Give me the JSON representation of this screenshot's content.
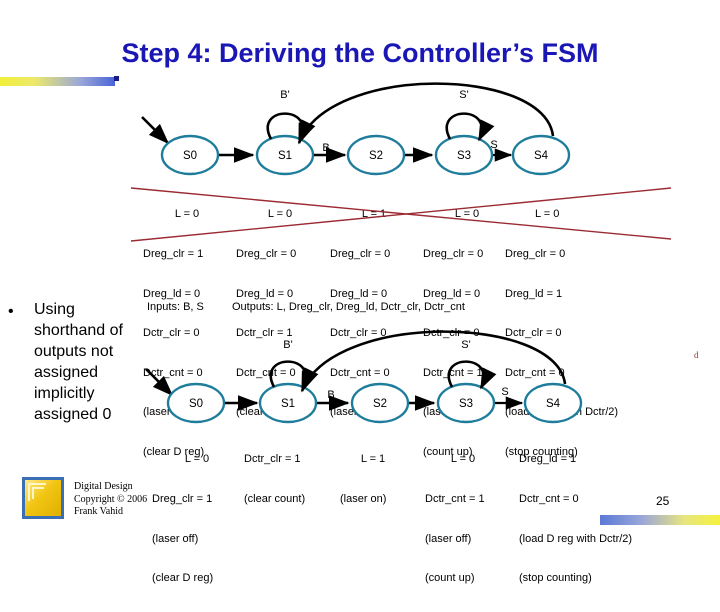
{
  "slide": {
    "title": "Step 4: Deriving the Controller’s FSM",
    "page_number": "25",
    "stray_mark": "d",
    "accent_color_start": "#f2ef3a",
    "accent_color_end": "#4a63d8",
    "title_color": "#1a17b5",
    "state_circle_color": "#1f7d9c",
    "strikeout_color": "#9c2a33"
  },
  "bullet": {
    "marker": "•",
    "text": "Using shorthand of outputs not assigned implicitly assigned 0"
  },
  "io_line": {
    "inputs": "Inputs: B, S",
    "outputs": "Outputs: L, Dreg_clr, Dreg_ld, Dctr_clr, Dctr_cnt"
  },
  "fsm_full": {
    "states": [
      "S0",
      "S1",
      "S2",
      "S3",
      "S4"
    ],
    "self_loop_labels": [
      {
        "state": "S1",
        "label": "B'"
      },
      {
        "state": "S3",
        "label": "S'"
      }
    ],
    "transition_labels": [
      {
        "from": "S1",
        "to": "S2",
        "label": "B"
      },
      {
        "from": "S3",
        "to": "S4",
        "label": "S"
      }
    ],
    "back_arc": {
      "from": "S4",
      "to": "S1",
      "label": ""
    },
    "outputs": [
      {
        "state": "S0",
        "header": "L = 0",
        "lines": [
          "Dreg_clr = 1",
          "Dreg_ld = 0",
          "Dctr_clr = 0",
          "Dctr_cnt = 0",
          "(laser off)",
          "(clear D reg)"
        ]
      },
      {
        "state": "S1",
        "header": "L = 0",
        "lines": [
          "Dreg_clr = 0",
          "Dreg_ld = 0",
          "Dctr_clr = 1",
          "Dctr_cnt = 0",
          "(clear count)"
        ]
      },
      {
        "state": "S2",
        "header": "L = 1",
        "lines": [
          "Dreg_clr = 0",
          "Dreg_ld = 0",
          "Dctr_clr = 0",
          "Dctr_cnt = 0",
          "(laser on)"
        ]
      },
      {
        "state": "S3",
        "header": "L = 0",
        "lines": [
          "Dreg_clr = 0",
          "Dreg_ld = 0",
          "Dctr_clr = 0",
          "Dctr_cnt = 1",
          "(laser off)",
          "(count up)"
        ]
      },
      {
        "state": "S4",
        "header": "L = 0",
        "lines": [
          "Dreg_clr = 0",
          "Dreg_ld = 1",
          "Dctr_clr = 0",
          "Dctr_cnt = 0",
          "(load D reg with Dctr/2)",
          "(stop counting)"
        ]
      }
    ]
  },
  "fsm_shorthand": {
    "states": [
      "S0",
      "S1",
      "S2",
      "S3",
      "S4"
    ],
    "self_loop_labels": [
      {
        "state": "S1",
        "label": "B'"
      },
      {
        "state": "S3",
        "label": "S'"
      }
    ],
    "transition_labels": [
      {
        "from": "S1",
        "to": "S2",
        "label": "B"
      },
      {
        "from": "S3",
        "to": "S4",
        "label": "S"
      }
    ],
    "back_arc": {
      "from": "S4",
      "to": "S1",
      "label": ""
    },
    "outputs": [
      {
        "state": "S0",
        "header": "L = 0",
        "lines": [
          "Dreg_clr = 1",
          "(laser off)",
          "(clear D reg)"
        ]
      },
      {
        "state": "S1",
        "header": "Dctr_clr = 1",
        "lines": [
          "(clear count)"
        ]
      },
      {
        "state": "S2",
        "header": "L = 1",
        "lines": [
          "(laser on)"
        ]
      },
      {
        "state": "S3",
        "header": "L = 0",
        "lines": [
          "Dctr_cnt = 1",
          "(laser off)",
          "(count up)"
        ]
      },
      {
        "state": "S4",
        "header": "Dreg_ld = 1",
        "lines": [
          "Dctr_cnt = 0",
          "(load D reg with Dctr/2)",
          "(stop counting)"
        ]
      }
    ]
  },
  "footer": {
    "credit": "Digital Design\nCopyright © 2006\nFrank Vahid"
  }
}
